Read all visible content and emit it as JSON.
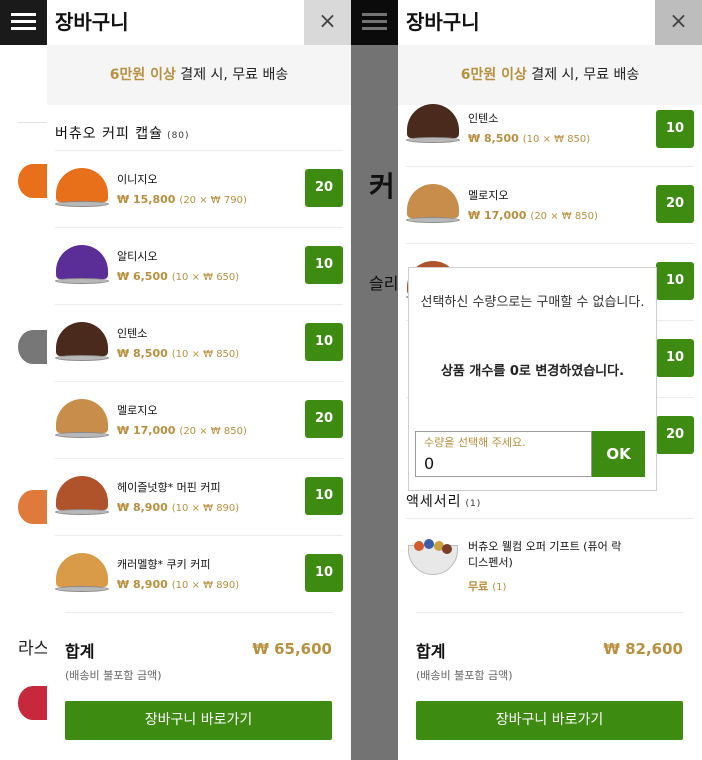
{
  "cart_title": "장바구니",
  "close_glyph": "×",
  "banner": {
    "highlight": "6만원 이상",
    "rest": " 결제 시, 무료 배송"
  },
  "section_capsules": {
    "label": "버츄오 커피 캡슐",
    "count": "(80)"
  },
  "section_accessories": {
    "label": "액세서리",
    "count": "(1)"
  },
  "items": [
    {
      "name": "이니지오",
      "price": "₩ 15,800",
      "detail": "(20 × ₩ 790)",
      "qty": "20",
      "color": "#e8701a"
    },
    {
      "name": "알티시오",
      "price": "₩ 6,500",
      "detail": "(10 × ₩ 650)",
      "qty": "10",
      "color": "#5a2e96"
    },
    {
      "name": "인텐소",
      "price": "₩ 8,500",
      "detail": "(10 × ₩ 850)",
      "qty": "10",
      "color": "#4a2a1c"
    },
    {
      "name": "멜로지오",
      "price": "₩ 17,000",
      "detail": "(20 × ₩ 850)",
      "qty": "20",
      "color": "#c88d4a"
    },
    {
      "name": "헤이즐넛향* 머핀 커피",
      "price": "₩ 8,900",
      "detail": "(10 × ₩ 890)",
      "qty": "10",
      "color": "#b0522a"
    },
    {
      "name": "캐러멜향* 쿠키 커피",
      "price": "₩ 8,900",
      "detail": "(10 × ₩ 890)",
      "qty": "10",
      "color": "#d99b47"
    }
  ],
  "accessory": {
    "name_line1": "버츄오 웰컴 오퍼 기프트 (퓨어 락",
    "name_line2": "디스펜서)",
    "price": "무료",
    "detail": "(1)"
  },
  "panel1_total": {
    "label": "합계",
    "value": "₩ 65,600",
    "note": "(배송비 불포함 금액)"
  },
  "panel2_total": {
    "label": "합계",
    "value": "₩ 82,600",
    "note": "(배송비 불포함 금액)"
  },
  "go_button": "장바구니 바로가기",
  "dialog": {
    "line1": "선택하신 수량으로는 구매할 수 없습니다.",
    "line2": "상품 개수를 0로 변경하였습니다.",
    "input_placeholder": "수량을 선택해 주세요.",
    "input_value": "0",
    "ok": "OK"
  },
  "panel2_qtys": [
    "10",
    "20",
    "10",
    "10",
    "20"
  ],
  "bg": {
    "heading": "커",
    "sub": "슬리",
    "bottom": "라스"
  },
  "colors": {
    "accent_green": "#3d8b11",
    "gold": "#b8903f",
    "header_dark": "#1a1a1a"
  }
}
